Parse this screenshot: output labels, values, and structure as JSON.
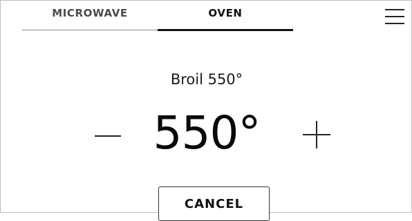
{
  "tabs": [
    {
      "label": "MICROWAVE",
      "active": false
    },
    {
      "label": "OVEN",
      "active": true
    }
  ],
  "menu": {
    "icon": "hamburger-menu-icon"
  },
  "mode": {
    "label": "Broil 550°"
  },
  "temperature": {
    "value": "550°",
    "decrease_icon": "minus-icon",
    "increase_icon": "plus-icon"
  },
  "actions": {
    "cancel_label": "CANCEL"
  },
  "colors": {
    "text": "#111111",
    "tab_inactive_text": "#4a4a4a",
    "active_underline": "#111111",
    "frame_border": "#bdbdbd"
  }
}
